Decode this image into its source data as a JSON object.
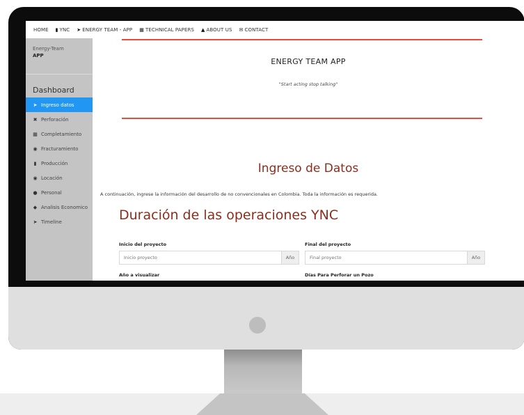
{
  "topnav": {
    "items": [
      {
        "label": "HOME",
        "icon": ""
      },
      {
        "label": "YNC",
        "icon": "file-icon"
      },
      {
        "label": "ENERGY TEAM - APP",
        "icon": "paper-plane-icon"
      },
      {
        "label": "TECHNICAL PAPERS",
        "icon": "grid-icon"
      },
      {
        "label": "ABOUT US",
        "icon": "user-icon"
      },
      {
        "label": "CONTACT",
        "icon": "envelope-icon"
      }
    ]
  },
  "sidebar": {
    "brand_line1": "Energy-Team",
    "brand_line2": "APP",
    "section": "Dashboard",
    "items": [
      {
        "label": "Ingreso datos",
        "icon": "arrow-up-icon"
      },
      {
        "label": "Perforación",
        "icon": "cross-icon"
      },
      {
        "label": "Completamiento",
        "icon": "grid-icon"
      },
      {
        "label": "Fracturamiento",
        "icon": "target-icon"
      },
      {
        "label": "Producción",
        "icon": "file-icon"
      },
      {
        "label": "Locación",
        "icon": "eye-icon"
      },
      {
        "label": "Personal",
        "icon": "users-icon"
      },
      {
        "label": "Analisis Economico",
        "icon": "diamond-icon"
      },
      {
        "label": "Timeline",
        "icon": "paper-plane-icon"
      }
    ]
  },
  "main": {
    "app_title": "ENERGY TEAM APP",
    "motto": "\"Start acting stop talking\"",
    "heading": "Ingreso de Datos",
    "intro": "A continuación, ingrese la información del desarrollo de no convencionales en Colombia. Toda la información es requerida.",
    "section_heading": "Duración de las operaciones YNC",
    "fields": {
      "inicio_label": "Inicio del proyecto",
      "inicio_placeholder": "Inicio proyecto",
      "inicio_addon": "Año",
      "final_label": "Final del proyecto",
      "final_placeholder": "Final proyecto",
      "final_addon": "Año",
      "ano_label": "Año a visualizar",
      "dias_label": "Días Para Perforar un Pozo"
    }
  },
  "colors": {
    "accent": "#2196f3",
    "heading": "#8b2e1c",
    "divider": "#e74c3c",
    "sidebar_bg": "#c4c4c4"
  }
}
